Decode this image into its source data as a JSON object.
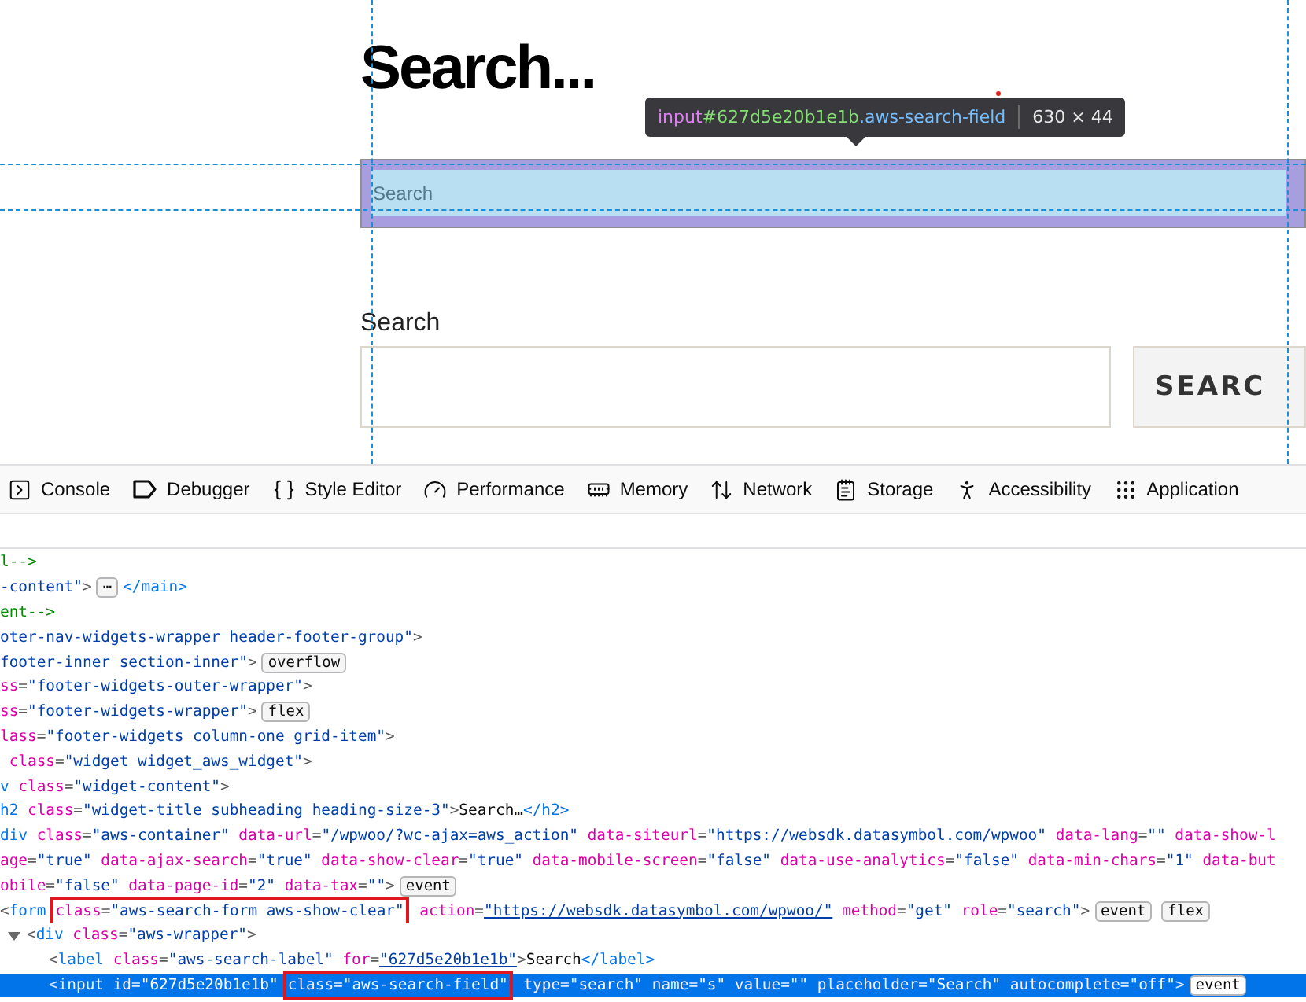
{
  "page": {
    "heading": "Search...",
    "tooltip": {
      "tag": "input",
      "id": "#627d5e20b1e1b",
      "class": ".aws-search-field",
      "size": "630 × 44"
    },
    "highlighted_field": {
      "placeholder": "Search"
    },
    "search_label": "Search",
    "search_button": "SEARC"
  },
  "toolbar": {
    "tabs": [
      {
        "kind": "console",
        "label": "Console"
      },
      {
        "kind": "debugger",
        "label": "Debugger"
      },
      {
        "kind": "style",
        "label": "Style Editor"
      },
      {
        "kind": "performance",
        "label": "Performance"
      },
      {
        "kind": "memory",
        "label": "Memory"
      },
      {
        "kind": "network",
        "label": "Network"
      },
      {
        "kind": "storage",
        "label": "Storage"
      },
      {
        "kind": "accessibility",
        "label": "Accessibility"
      },
      {
        "kind": "application",
        "label": "Application"
      }
    ]
  },
  "code_lines": [
    {
      "selected": false,
      "tokens": [
        {
          "kind": "comment",
          "text": "l-->"
        }
      ]
    },
    {
      "selected": false,
      "tokens": [
        {
          "kind": "value",
          "text": "-content\""
        },
        {
          "kind": "punct",
          "text": ">"
        },
        {
          "kind": "badge",
          "text": "⋯"
        },
        {
          "kind": "tag",
          "text": "</main>"
        }
      ]
    },
    {
      "selected": false,
      "tokens": [
        {
          "kind": "comment",
          "text": "ent-->"
        }
      ]
    },
    {
      "selected": false,
      "tokens": [
        {
          "kind": "value",
          "text": "oter-nav-widgets-wrapper header-footer-group\""
        },
        {
          "kind": "punct",
          "text": ">"
        }
      ]
    },
    {
      "selected": false,
      "tokens": [
        {
          "kind": "value",
          "text": "footer-inner section-inner\""
        },
        {
          "kind": "punct",
          "text": ">"
        },
        {
          "kind": "badge",
          "text": "overflow"
        }
      ]
    },
    {
      "selected": false,
      "tokens": [
        {
          "kind": "attr",
          "text": "ss"
        },
        {
          "kind": "punct",
          "text": "="
        },
        {
          "kind": "value",
          "text": "\"footer-widgets-outer-wrapper\""
        },
        {
          "kind": "punct",
          "text": ">"
        }
      ]
    },
    {
      "selected": false,
      "tokens": [
        {
          "kind": "attr",
          "text": "ss"
        },
        {
          "kind": "punct",
          "text": "="
        },
        {
          "kind": "value",
          "text": "\"footer-widgets-wrapper\""
        },
        {
          "kind": "punct",
          "text": ">"
        },
        {
          "kind": "badge",
          "text": "flex"
        }
      ]
    },
    {
      "selected": false,
      "tokens": [
        {
          "kind": "attr",
          "text": "lass"
        },
        {
          "kind": "punct",
          "text": "="
        },
        {
          "kind": "value",
          "text": "\"footer-widgets column-one grid-item\""
        },
        {
          "kind": "punct",
          "text": ">"
        }
      ]
    },
    {
      "selected": false,
      "tokens": [
        {
          "kind": "attr",
          "text": " class"
        },
        {
          "kind": "punct",
          "text": "="
        },
        {
          "kind": "value",
          "text": "\"widget widget_aws_widget\""
        },
        {
          "kind": "punct",
          "text": ">"
        }
      ]
    },
    {
      "selected": false,
      "tokens": [
        {
          "kind": "tag",
          "text": "v"
        },
        {
          "kind": "attr",
          "text": " class"
        },
        {
          "kind": "punct",
          "text": "="
        },
        {
          "kind": "value",
          "text": "\"widget-content\""
        },
        {
          "kind": "punct",
          "text": ">"
        }
      ]
    },
    {
      "selected": false,
      "tokens": [
        {
          "kind": "tag",
          "text": "h2"
        },
        {
          "kind": "attr",
          "text": " class"
        },
        {
          "kind": "punct",
          "text": "="
        },
        {
          "kind": "value",
          "text": "\"widget-title subheading heading-size-3\""
        },
        {
          "kind": "punct",
          "text": ">"
        },
        {
          "kind": "text",
          "text": "Search…"
        },
        {
          "kind": "tag",
          "text": "</h2>"
        }
      ]
    },
    {
      "selected": false,
      "tokens": [
        {
          "kind": "tag",
          "text": "div"
        },
        {
          "kind": "attr",
          "text": " class"
        },
        {
          "kind": "punct",
          "text": "="
        },
        {
          "kind": "value",
          "text": "\"aws-container\""
        },
        {
          "kind": "attr",
          "text": " data-url"
        },
        {
          "kind": "punct",
          "text": "="
        },
        {
          "kind": "value",
          "text": "\"/wpwoo/?wc-ajax=aws_action\""
        },
        {
          "kind": "attr",
          "text": " data-siteurl"
        },
        {
          "kind": "punct",
          "text": "="
        },
        {
          "kind": "value",
          "text": "\"https://websdk.datasymbol.com/wpwoo\""
        },
        {
          "kind": "attr",
          "text": " data-lang"
        },
        {
          "kind": "punct",
          "text": "="
        },
        {
          "kind": "value",
          "text": "\"\""
        },
        {
          "kind": "attr",
          "text": " data-show-l"
        }
      ]
    },
    {
      "selected": false,
      "tokens": [
        {
          "kind": "attr",
          "text": "age"
        },
        {
          "kind": "punct",
          "text": "="
        },
        {
          "kind": "value",
          "text": "\"true\""
        },
        {
          "kind": "attr",
          "text": " data-ajax-search"
        },
        {
          "kind": "punct",
          "text": "="
        },
        {
          "kind": "value",
          "text": "\"true\""
        },
        {
          "kind": "attr",
          "text": " data-show-clear"
        },
        {
          "kind": "punct",
          "text": "="
        },
        {
          "kind": "value",
          "text": "\"true\""
        },
        {
          "kind": "attr",
          "text": " data-mobile-screen"
        },
        {
          "kind": "punct",
          "text": "="
        },
        {
          "kind": "value",
          "text": "\"false\""
        },
        {
          "kind": "attr",
          "text": " data-use-analytics"
        },
        {
          "kind": "punct",
          "text": "="
        },
        {
          "kind": "value",
          "text": "\"false\""
        },
        {
          "kind": "attr",
          "text": " data-min-chars"
        },
        {
          "kind": "punct",
          "text": "="
        },
        {
          "kind": "value",
          "text": "\"1\""
        },
        {
          "kind": "attr",
          "text": " data-but"
        }
      ]
    },
    {
      "selected": false,
      "tokens": [
        {
          "kind": "attr",
          "text": "obile"
        },
        {
          "kind": "punct",
          "text": "="
        },
        {
          "kind": "value",
          "text": "\"false\""
        },
        {
          "kind": "attr",
          "text": " data-page-id"
        },
        {
          "kind": "punct",
          "text": "="
        },
        {
          "kind": "value",
          "text": "\"2\""
        },
        {
          "kind": "attr",
          "text": " data-tax"
        },
        {
          "kind": "punct",
          "text": "="
        },
        {
          "kind": "value",
          "text": "\"\""
        },
        {
          "kind": "punct",
          "text": ">"
        },
        {
          "kind": "badge",
          "text": "event"
        }
      ]
    },
    {
      "selected": false,
      "tokens": [
        {
          "kind": "punct",
          "text": "<"
        },
        {
          "kind": "tag",
          "text": "form"
        },
        {
          "kind": "outlined",
          "tokens": [
            {
              "kind": "attr",
              "text": "class"
            },
            {
              "kind": "punct",
              "text": "="
            },
            {
              "kind": "value",
              "text": "\"aws-search-form aws-show-clear\""
            }
          ]
        },
        {
          "kind": "attr",
          "text": " action"
        },
        {
          "kind": "punct",
          "text": "="
        },
        {
          "kind": "link",
          "text": "\"https://websdk.datasymbol.com/wpwoo/\""
        },
        {
          "kind": "attr",
          "text": " method"
        },
        {
          "kind": "punct",
          "text": "="
        },
        {
          "kind": "value",
          "text": "\"get\""
        },
        {
          "kind": "attr",
          "text": " role"
        },
        {
          "kind": "punct",
          "text": "="
        },
        {
          "kind": "value",
          "text": "\"search\""
        },
        {
          "kind": "punct",
          "text": ">"
        },
        {
          "kind": "badge",
          "text": "event"
        },
        {
          "kind": "badge",
          "text": "flex"
        }
      ],
      "children": [
        {
          "selected": false,
          "expanded": true,
          "tokens": [
            {
              "kind": "punct",
              "text": "<"
            },
            {
              "kind": "tag",
              "text": "div"
            },
            {
              "kind": "attr",
              "text": " class"
            },
            {
              "kind": "punct",
              "text": "="
            },
            {
              "kind": "value",
              "text": "\"aws-wrapper\""
            },
            {
              "kind": "punct",
              "text": ">"
            }
          ],
          "children": [
            {
              "selected": false,
              "tokens": [
                {
                  "kind": "punct",
                  "text": "<"
                },
                {
                  "kind": "tag",
                  "text": "label"
                },
                {
                  "kind": "attr",
                  "text": " class"
                },
                {
                  "kind": "punct",
                  "text": "="
                },
                {
                  "kind": "value",
                  "text": "\"aws-search-label\""
                },
                {
                  "kind": "attr",
                  "text": " for"
                },
                {
                  "kind": "punct",
                  "text": "="
                },
                {
                  "kind": "link",
                  "text": "\"627d5e20b1e1b\""
                },
                {
                  "kind": "punct",
                  "text": ">"
                },
                {
                  "kind": "text",
                  "text": "Search"
                },
                {
                  "kind": "tag",
                  "text": "</label>"
                }
              ]
            },
            {
              "selected": true,
              "tokens": [
                {
                  "kind": "punct",
                  "text": "<"
                },
                {
                  "kind": "tag",
                  "text": "input"
                },
                {
                  "kind": "attr",
                  "text": " id"
                },
                {
                  "kind": "punct",
                  "text": "="
                },
                {
                  "kind": "value",
                  "text": "\"627d5e20b1e1b\""
                },
                {
                  "kind": "outlined",
                  "tokens": [
                    {
                      "kind": "attr",
                      "text": "class"
                    },
                    {
                      "kind": "punct",
                      "text": "="
                    },
                    {
                      "kind": "value",
                      "text": "\"aws-search-field\""
                    }
                  ]
                },
                {
                  "kind": "attr",
                  "text": " type"
                },
                {
                  "kind": "punct",
                  "text": "="
                },
                {
                  "kind": "value",
                  "text": "\"search\""
                },
                {
                  "kind": "attr",
                  "text": " name"
                },
                {
                  "kind": "punct",
                  "text": "="
                },
                {
                  "kind": "value",
                  "text": "\"s\""
                },
                {
                  "kind": "attr",
                  "text": " value"
                },
                {
                  "kind": "punct",
                  "text": "="
                },
                {
                  "kind": "value",
                  "text": "\"\""
                },
                {
                  "kind": "attr",
                  "text": " placeholder"
                },
                {
                  "kind": "punct",
                  "text": "="
                },
                {
                  "kind": "value",
                  "text": "\"Search\""
                },
                {
                  "kind": "attr",
                  "text": " autocomplete"
                },
                {
                  "kind": "punct",
                  "text": "="
                },
                {
                  "kind": "value",
                  "text": "\"off\""
                },
                {
                  "kind": "punct",
                  "text": ">"
                },
                {
                  "kind": "badge",
                  "text": "event"
                }
              ]
            }
          ]
        }
      ]
    }
  ]
}
